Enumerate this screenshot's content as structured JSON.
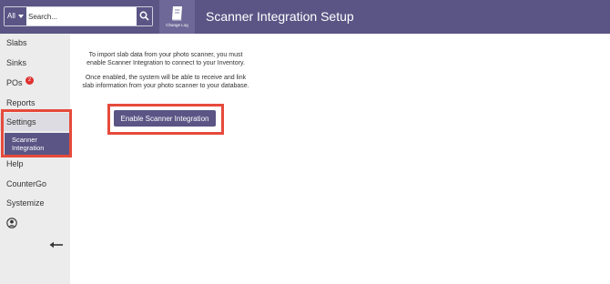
{
  "header": {
    "search": {
      "scope": "All",
      "placeholder": "Search..."
    },
    "changelog_label": "Change Log",
    "title": "Scanner Integration Setup"
  },
  "sidebar": {
    "items": [
      {
        "label": "Slabs"
      },
      {
        "label": "Sinks"
      },
      {
        "label": "POs",
        "badge": "2"
      },
      {
        "label": "Reports"
      },
      {
        "label": "Settings"
      },
      {
        "label": "Help"
      },
      {
        "label": "CounterGo"
      },
      {
        "label": "Systemize"
      }
    ],
    "subitem": {
      "line1": "Scanner",
      "line2": "Integration"
    }
  },
  "main": {
    "paragraph1": "To import slab data from your photo scanner, you must enable Scanner Integration to connect to your Inventory.",
    "paragraph2": "Once enabled, the system will be able to receive and link slab information from your photo scanner to your database.",
    "enable_button": "Enable Scanner Integration"
  },
  "colors": {
    "primary": "#5a5585",
    "highlight": "#e64a3b",
    "badge": "#e03131",
    "sidebar_bg": "#ececec"
  },
  "icons": [
    "chevron-down-icon",
    "search-icon",
    "notebook-icon",
    "user-icon",
    "arrow-left-icon"
  ]
}
